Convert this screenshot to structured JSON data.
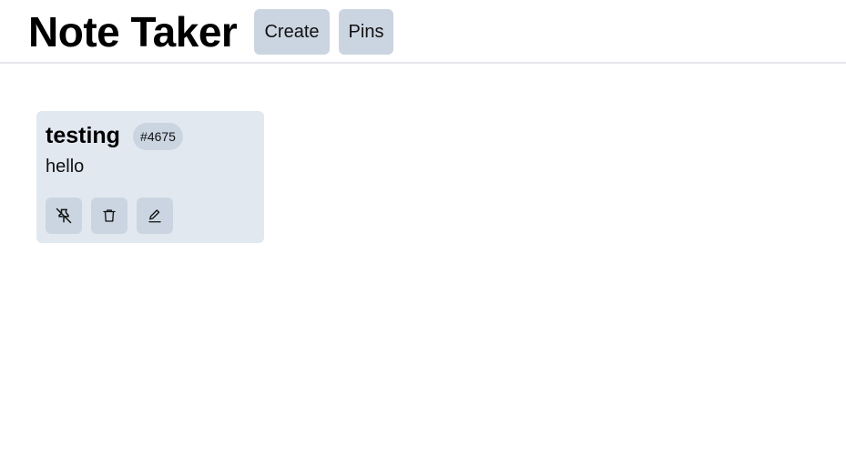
{
  "header": {
    "app_title": "Note Taker",
    "nav": [
      {
        "label": "Create"
      },
      {
        "label": "Pins"
      }
    ]
  },
  "notes": [
    {
      "title": "testing",
      "tag": "#4675",
      "body": "hello",
      "actions": [
        {
          "icon": "pin-off-icon"
        },
        {
          "icon": "trash-icon"
        },
        {
          "icon": "pencil-icon"
        }
      ]
    }
  ],
  "colors": {
    "button_bg": "#cbd5e1",
    "card_bg": "#e2e8f0",
    "divider": "#e5e7eb"
  }
}
